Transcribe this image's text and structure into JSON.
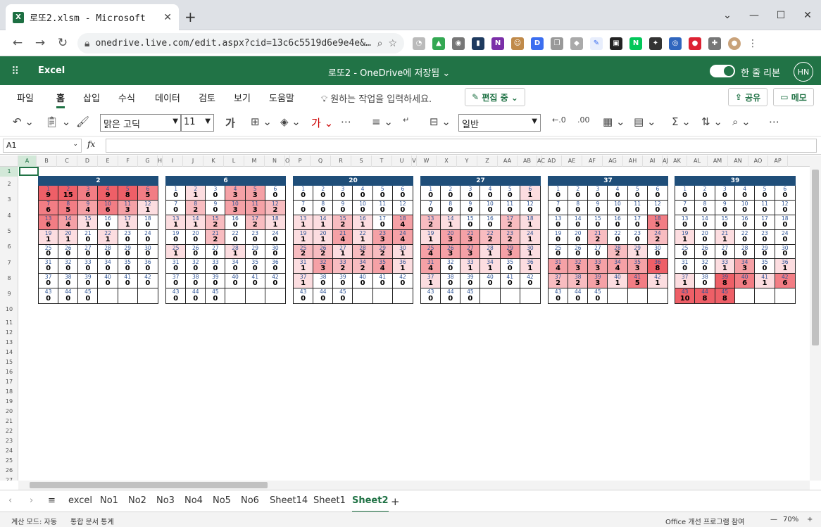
{
  "browser": {
    "tab_title": "로또2.xlsm - Microsoft",
    "url": "onedrive.live.com/edit.aspx?cid=13c6c5519d6e9e4e&…"
  },
  "excel": {
    "app_name": "Excel",
    "doc_title": "로또2 - OneDrive에 저장됨 ⌄",
    "simplified_label": "한 줄 리본",
    "avatar": "HN",
    "menus": [
      "파일",
      "홈",
      "삽입",
      "수식",
      "데이터",
      "검토",
      "보기",
      "도움말"
    ],
    "tell_me": "원하는 작업을 입력하세요.",
    "edit_mode": "편집 중 ⌄",
    "share": "공유",
    "memo": "메모",
    "font_name": "맑은 고딕",
    "font_size": "11",
    "number_format": "일반",
    "name_box": "A1",
    "fx": "fx"
  },
  "columns": [
    "A",
    "B",
    "C",
    "D",
    "E",
    "F",
    "G",
    "H",
    "I",
    "J",
    "K",
    "L",
    "M",
    "N",
    "O",
    "P",
    "Q",
    "R",
    "S",
    "T",
    "U",
    "V",
    "W",
    "X",
    "Y",
    "Z",
    "AA",
    "AB",
    "AC",
    "AD",
    "AE",
    "AF",
    "AG",
    "AH",
    "AI",
    "AJ",
    "AK",
    "AL",
    "AM",
    "AN",
    "AO",
    "AP"
  ],
  "rows": [
    "1",
    "2",
    "3",
    "4",
    "5",
    "6",
    "7",
    "8",
    "9",
    "10",
    "11",
    "12",
    "13",
    "14",
    "15",
    "16",
    "17",
    "18",
    "19",
    "20",
    "21",
    "22",
    "23",
    "24",
    "25",
    "26",
    "27",
    "28"
  ],
  "blocks": [
    {
      "title": "2",
      "values": [
        9,
        15,
        6,
        9,
        8,
        5,
        6,
        5,
        4,
        6,
        3,
        1,
        6,
        4,
        1,
        0,
        1,
        0,
        1,
        1,
        0,
        1,
        0,
        0,
        0,
        0,
        0,
        0,
        0,
        0,
        0,
        0,
        0,
        0,
        0,
        0,
        0,
        0,
        0,
        0,
        0,
        0,
        0,
        0,
        0
      ]
    },
    {
      "title": "6",
      "values": [
        0,
        1,
        0,
        3,
        3,
        0,
        0,
        2,
        0,
        3,
        3,
        2,
        1,
        1,
        2,
        0,
        2,
        1,
        0,
        0,
        2,
        0,
        0,
        0,
        1,
        0,
        0,
        1,
        0,
        0,
        0,
        0,
        0,
        0,
        0,
        0,
        0,
        0,
        0,
        0,
        0,
        0,
        0,
        0,
        0
      ]
    },
    {
      "title": "20",
      "values": [
        0,
        0,
        0,
        0,
        0,
        0,
        0,
        0,
        0,
        0,
        0,
        0,
        1,
        1,
        2,
        1,
        0,
        4,
        1,
        1,
        4,
        1,
        3,
        4,
        2,
        2,
        1,
        2,
        2,
        1,
        1,
        3,
        2,
        2,
        4,
        1,
        1,
        0,
        0,
        0,
        0,
        0,
        0,
        0,
        0,
        0,
        0,
        0
      ]
    },
    {
      "title": "27",
      "values": [
        0,
        0,
        0,
        0,
        0,
        1,
        0,
        0,
        0,
        0,
        0,
        0,
        2,
        1,
        0,
        0,
        2,
        1,
        1,
        3,
        3,
        2,
        2,
        1,
        4,
        3,
        3,
        1,
        3,
        1,
        4,
        0,
        1,
        1,
        0,
        1,
        1,
        0,
        0,
        0,
        0,
        0,
        0,
        0,
        0
      ]
    },
    {
      "title": "37",
      "values": [
        0,
        0,
        0,
        0,
        0,
        0,
        0,
        0,
        0,
        0,
        0,
        0,
        0,
        0,
        0,
        0,
        0,
        5,
        0,
        0,
        2,
        0,
        0,
        2,
        0,
        0,
        0,
        2,
        1,
        0,
        4,
        3,
        3,
        4,
        3,
        8,
        2,
        2,
        3,
        1,
        5,
        1,
        0,
        0,
        0
      ]
    },
    {
      "title": "39",
      "values": [
        0,
        0,
        0,
        0,
        0,
        0,
        0,
        0,
        0,
        0,
        0,
        0,
        0,
        0,
        0,
        0,
        0,
        0,
        1,
        0,
        1,
        0,
        0,
        0,
        0,
        0,
        0,
        0,
        0,
        0,
        0,
        0,
        1,
        3,
        0,
        1,
        1,
        0,
        8,
        6,
        1,
        6,
        10,
        8,
        8
      ]
    }
  ],
  "sheet_tabs": [
    "excel",
    "No1",
    "No2",
    "No3",
    "No4",
    "No5",
    "No6",
    "Sheet14",
    "Sheet1",
    "Sheet2"
  ],
  "active_sheet": "Sheet2",
  "status": {
    "calc_mode": "계산 모드: 자동",
    "workbook_stats": "통합 문서 통계",
    "feedback": "Office 개선 프로그램 참여",
    "zoom": "70%"
  },
  "colors": {
    "excel_green": "#217346",
    "header_navy": "#1f4e79",
    "heat_high": "#f0646c",
    "heat_low": "#fde2e4"
  }
}
